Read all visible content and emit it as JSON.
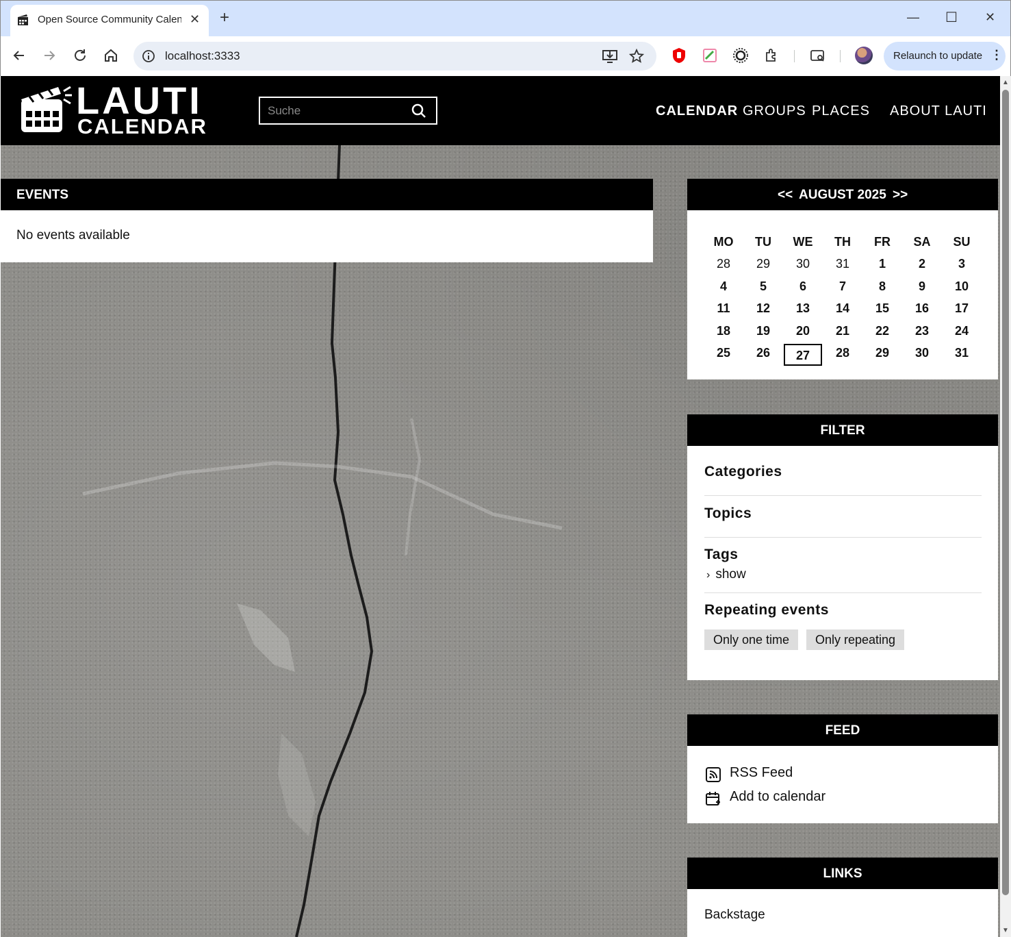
{
  "browser": {
    "tab_title": "Open Source Community Calen",
    "url": "localhost:3333",
    "relaunch_label": "Relaunch to update"
  },
  "header": {
    "logo_top": "LAUTI",
    "logo_bottom": "CALENDAR",
    "search_placeholder": "Suche",
    "nav": [
      "CALENDAR",
      "GROUPS",
      "PLACES",
      "ABOUT LAUTI"
    ]
  },
  "events": {
    "title": "EVENTS",
    "empty_text": "No events available"
  },
  "calendar": {
    "prev": "<<",
    "month": "AUGUST 2025",
    "next": ">>",
    "weekdays": [
      "MO",
      "TU",
      "WE",
      "TH",
      "FR",
      "SA",
      "SU"
    ],
    "weeks": [
      [
        "28",
        "29",
        "30",
        "31",
        "1",
        "2",
        "3"
      ],
      [
        "4",
        "5",
        "6",
        "7",
        "8",
        "9",
        "10"
      ],
      [
        "11",
        "12",
        "13",
        "14",
        "15",
        "16",
        "17"
      ],
      [
        "18",
        "19",
        "20",
        "21",
        "22",
        "23",
        "24"
      ],
      [
        "25",
        "26",
        "27",
        "28",
        "29",
        "30",
        "31"
      ]
    ],
    "today": "27"
  },
  "filter": {
    "title": "FILTER",
    "categories": "Categories",
    "topics": "Topics",
    "tags": "Tags",
    "tags_toggle": "show",
    "repeating": "Repeating events",
    "chip_one_time": "Only one time",
    "chip_repeating": "Only repeating"
  },
  "feed": {
    "title": "FEED",
    "rss": "RSS Feed",
    "add_calendar": "Add to calendar"
  },
  "links": {
    "title": "LINKS",
    "backstage": "Backstage"
  }
}
